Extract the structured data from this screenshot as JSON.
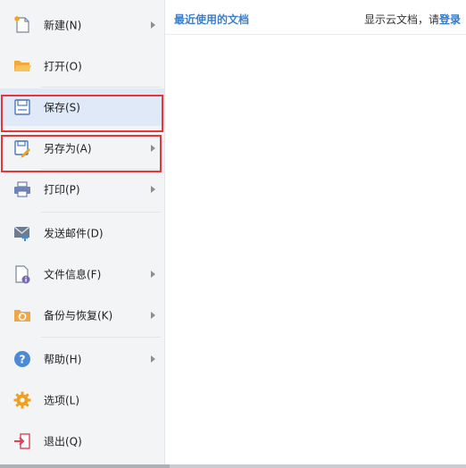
{
  "menu": {
    "items": [
      {
        "label": "新建(N)",
        "icon": "new-file-icon",
        "submenu": true
      },
      {
        "label": "打开(O)",
        "icon": "open-folder-icon",
        "submenu": false
      },
      {
        "label": "保存(S)",
        "icon": "save-icon",
        "submenu": false,
        "active": true
      },
      {
        "label": "另存为(A)",
        "icon": "save-as-icon",
        "submenu": true
      },
      {
        "label": "打印(P)",
        "icon": "printer-icon",
        "submenu": true
      },
      {
        "label": "发送邮件(D)",
        "icon": "mail-icon",
        "submenu": false
      },
      {
        "label": "文件信息(F)",
        "icon": "file-info-icon",
        "submenu": true
      },
      {
        "label": "备份与恢复(K)",
        "icon": "backup-restore-icon",
        "submenu": true
      },
      {
        "label": "帮助(H)",
        "icon": "help-icon",
        "submenu": true
      },
      {
        "label": "选项(L)",
        "icon": "gear-icon",
        "submenu": false
      },
      {
        "label": "退出(Q)",
        "icon": "exit-icon",
        "submenu": false
      }
    ]
  },
  "recent": {
    "title": "最近使用的文档",
    "cloud_prefix": "显示云文档，请",
    "login": "登录"
  },
  "colors": {
    "accent": "#3b7fcc",
    "highlight_box": "#e8353a",
    "active_bg": "#dfe9f7"
  }
}
